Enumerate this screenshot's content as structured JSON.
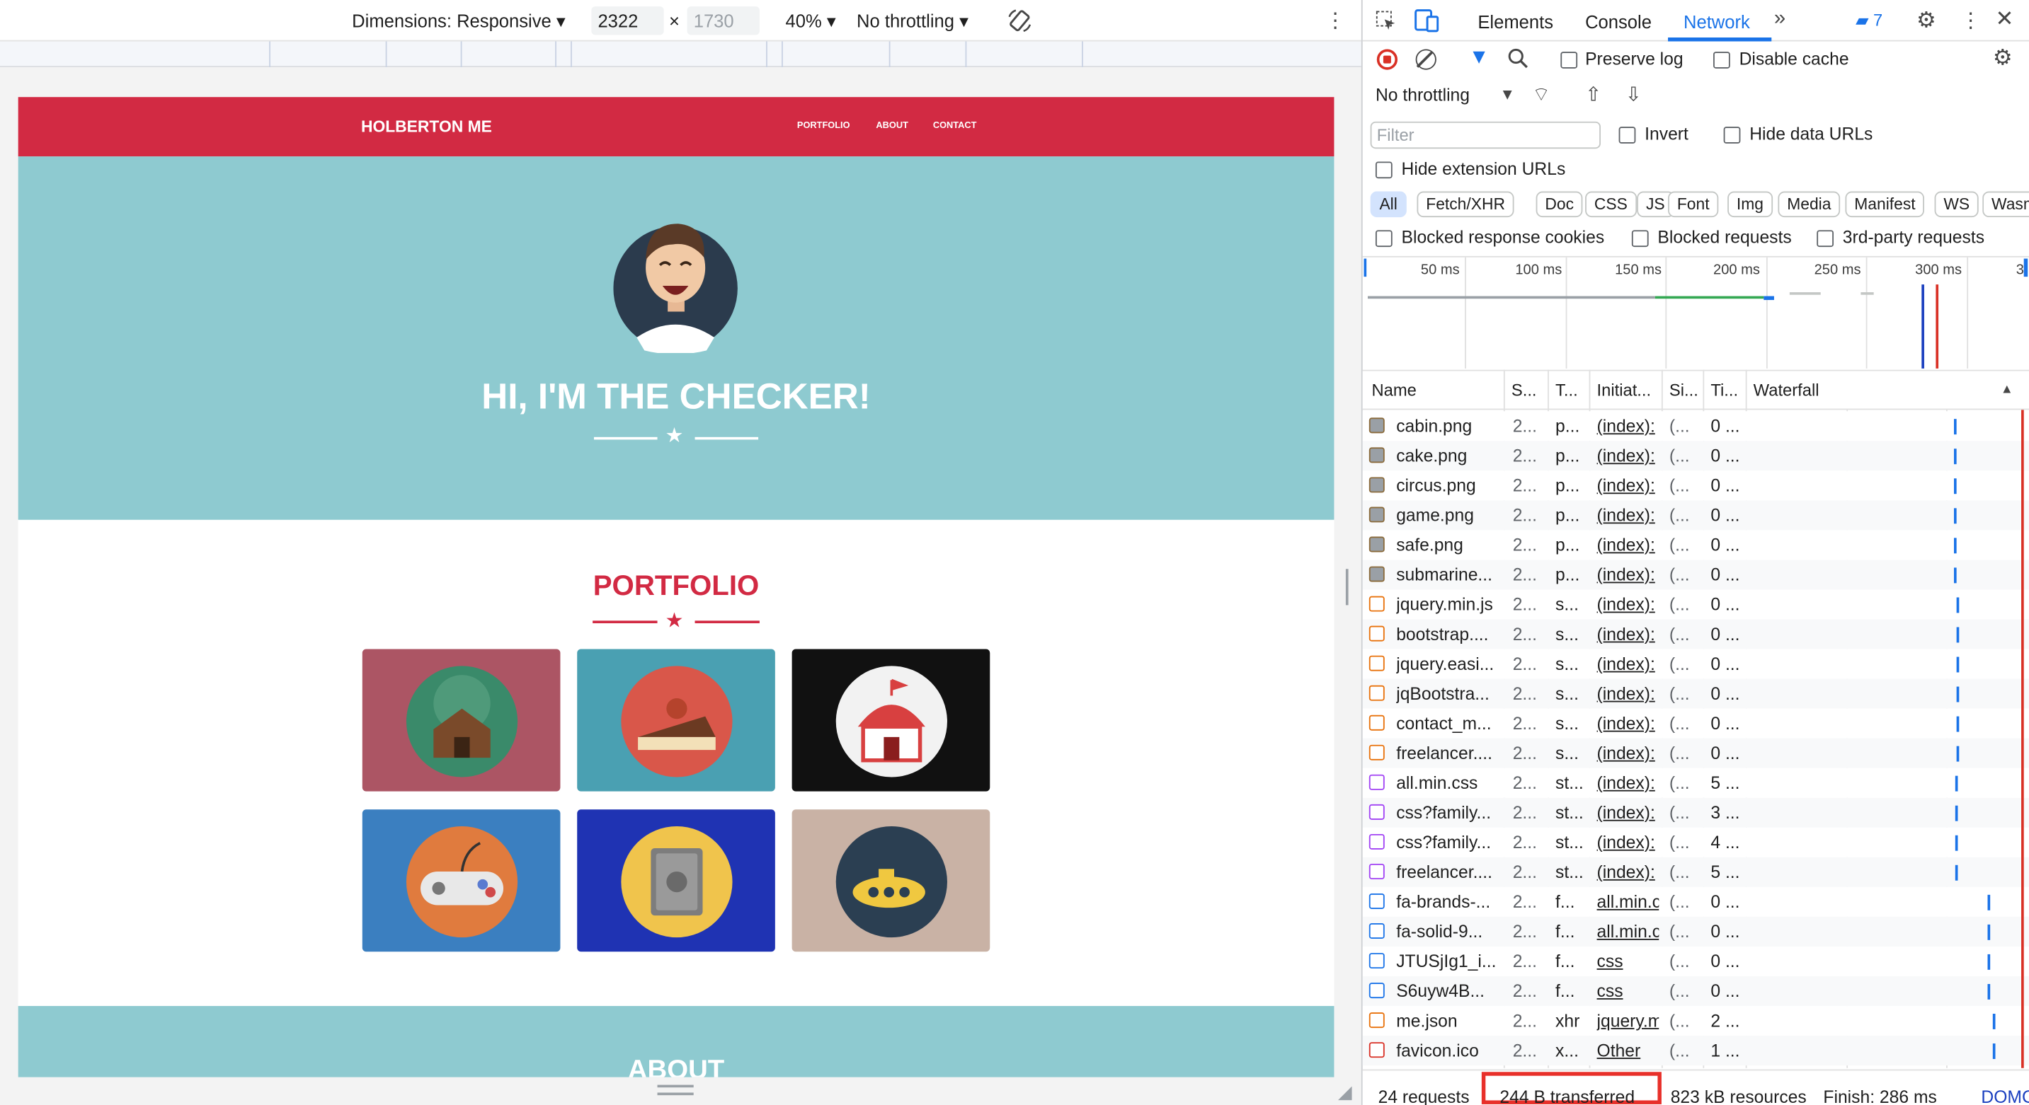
{
  "device_toolbar": {
    "dimensions_label": "Dimensions: Responsive",
    "width": "2322",
    "height": "1730",
    "times": "×",
    "zoom": "40%",
    "throttle": "No throttling"
  },
  "site": {
    "brand": "HOLBERTON ME",
    "nav": [
      "PORTFOLIO",
      "ABOUT",
      "CONTACT"
    ],
    "hero_title": "HI, I'M THE CHECKER!",
    "portfolio_title": "PORTFOLIO",
    "about_title": "ABOUT",
    "colors": {
      "nav": "#d22a43",
      "hero": "#8ecad0"
    },
    "tiles": [
      {
        "name": "cabin",
        "bg": "#ac5564",
        "circle": "#3a8a6a"
      },
      {
        "name": "cake",
        "bg": "#4aa0b2",
        "circle": "#d9574a"
      },
      {
        "name": "circus",
        "bg": "#111111",
        "circle": "#f2f2f2"
      },
      {
        "name": "game",
        "bg": "#3b7fc0",
        "circle": "#e07b3e"
      },
      {
        "name": "safe",
        "bg": "#1f33b3",
        "circle": "#f0c44c"
      },
      {
        "name": "submarine",
        "bg": "#c9b2a5",
        "circle": "#2b3f52"
      }
    ]
  },
  "devtools": {
    "tabs": [
      "Elements",
      "Console",
      "Network"
    ],
    "active_tab": "Network",
    "issues_count": "7",
    "preserve_log": "Preserve log",
    "disable_cache": "Disable cache",
    "throttling": "No throttling",
    "filter_placeholder": "Filter",
    "invert": "Invert",
    "hide_data_urls": "Hide data URLs",
    "hide_extension_urls": "Hide extension URLs",
    "type_filters": [
      "All",
      "Fetch/XHR",
      "Doc",
      "CSS",
      "JS",
      "Font",
      "Img",
      "Media",
      "Manifest",
      "WS",
      "Wasm"
    ],
    "blocked_response_cookies": "Blocked response cookies",
    "blocked_requests": "Blocked requests",
    "third_party": "3rd-party requests",
    "timeline_labels": [
      "50 ms",
      "100 ms",
      "150 ms",
      "200 ms",
      "250 ms",
      "300 ms",
      "3"
    ],
    "columns": [
      "Name",
      "S...",
      "T...",
      "Initiat...",
      "Si...",
      "Ti...",
      "Waterfall"
    ],
    "rows": [
      {
        "name": "cabin.png",
        "status": "2...",
        "type": "p...",
        "initiator": "(index):",
        "size": "(...",
        "time": "0 ...",
        "icon": "img"
      },
      {
        "name": "cake.png",
        "status": "2...",
        "type": "p...",
        "initiator": "(index):",
        "size": "(...",
        "time": "0 ...",
        "icon": "img"
      },
      {
        "name": "circus.png",
        "status": "2...",
        "type": "p...",
        "initiator": "(index):",
        "size": "(...",
        "time": "0 ...",
        "icon": "img"
      },
      {
        "name": "game.png",
        "status": "2...",
        "type": "p...",
        "initiator": "(index):",
        "size": "(...",
        "time": "0 ...",
        "icon": "img"
      },
      {
        "name": "safe.png",
        "status": "2...",
        "type": "p...",
        "initiator": "(index):",
        "size": "(...",
        "time": "0 ...",
        "icon": "img"
      },
      {
        "name": "submarine...",
        "status": "2...",
        "type": "p...",
        "initiator": "(index):",
        "size": "(...",
        "time": "0 ...",
        "icon": "img"
      },
      {
        "name": "jquery.min.js",
        "status": "2...",
        "type": "s...",
        "initiator": "(index):",
        "size": "(...",
        "time": "0 ...",
        "icon": "js"
      },
      {
        "name": "bootstrap....",
        "status": "2...",
        "type": "s...",
        "initiator": "(index):",
        "size": "(...",
        "time": "0 ...",
        "icon": "js"
      },
      {
        "name": "jquery.easi...",
        "status": "2...",
        "type": "s...",
        "initiator": "(index):",
        "size": "(...",
        "time": "0 ...",
        "icon": "js"
      },
      {
        "name": "jqBootstra...",
        "status": "2...",
        "type": "s...",
        "initiator": "(index):",
        "size": "(...",
        "time": "0 ...",
        "icon": "js"
      },
      {
        "name": "contact_m...",
        "status": "2...",
        "type": "s...",
        "initiator": "(index):",
        "size": "(...",
        "time": "0 ...",
        "icon": "js"
      },
      {
        "name": "freelancer....",
        "status": "2...",
        "type": "s...",
        "initiator": "(index):",
        "size": "(...",
        "time": "0 ...",
        "icon": "js"
      },
      {
        "name": "all.min.css",
        "status": "2...",
        "type": "st...",
        "initiator": "(index):",
        "size": "(...",
        "time": "5 ...",
        "icon": "css"
      },
      {
        "name": "css?family...",
        "status": "2...",
        "type": "st...",
        "initiator": "(index):",
        "size": "(...",
        "time": "3 ...",
        "icon": "css"
      },
      {
        "name": "css?family...",
        "status": "2...",
        "type": "st...",
        "initiator": "(index):",
        "size": "(...",
        "time": "4 ...",
        "icon": "css"
      },
      {
        "name": "freelancer....",
        "status": "2...",
        "type": "st...",
        "initiator": "(index):",
        "size": "(...",
        "time": "5 ...",
        "icon": "css"
      },
      {
        "name": "fa-brands-...",
        "status": "2...",
        "type": "f...",
        "initiator": "all.min.c",
        "size": "(...",
        "time": "0 ...",
        "icon": "font"
      },
      {
        "name": "fa-solid-9...",
        "status": "2...",
        "type": "f...",
        "initiator": "all.min.c",
        "size": "(...",
        "time": "0 ...",
        "icon": "font"
      },
      {
        "name": "JTUSjIg1_i...",
        "status": "2...",
        "type": "f...",
        "initiator": "css",
        "size": "(...",
        "time": "0 ...",
        "icon": "font"
      },
      {
        "name": "S6uyw4B...",
        "status": "2...",
        "type": "f...",
        "initiator": "css",
        "size": "(...",
        "time": "0 ...",
        "icon": "font"
      },
      {
        "name": "me.json",
        "status": "2...",
        "type": "xhr",
        "initiator": "jquery.m",
        "size": "(...",
        "time": "2 ...",
        "icon": "xhr"
      },
      {
        "name": "favicon.ico",
        "status": "2...",
        "type": "x...",
        "initiator": "Other",
        "size": "(...",
        "time": "1 ...",
        "icon": "ico"
      }
    ],
    "status_bar": {
      "requests": "24 requests",
      "transferred": "244 B transferred",
      "resources": "823 kB resources",
      "finish": "Finish: 286 ms",
      "domcontent": "DOMC"
    }
  }
}
